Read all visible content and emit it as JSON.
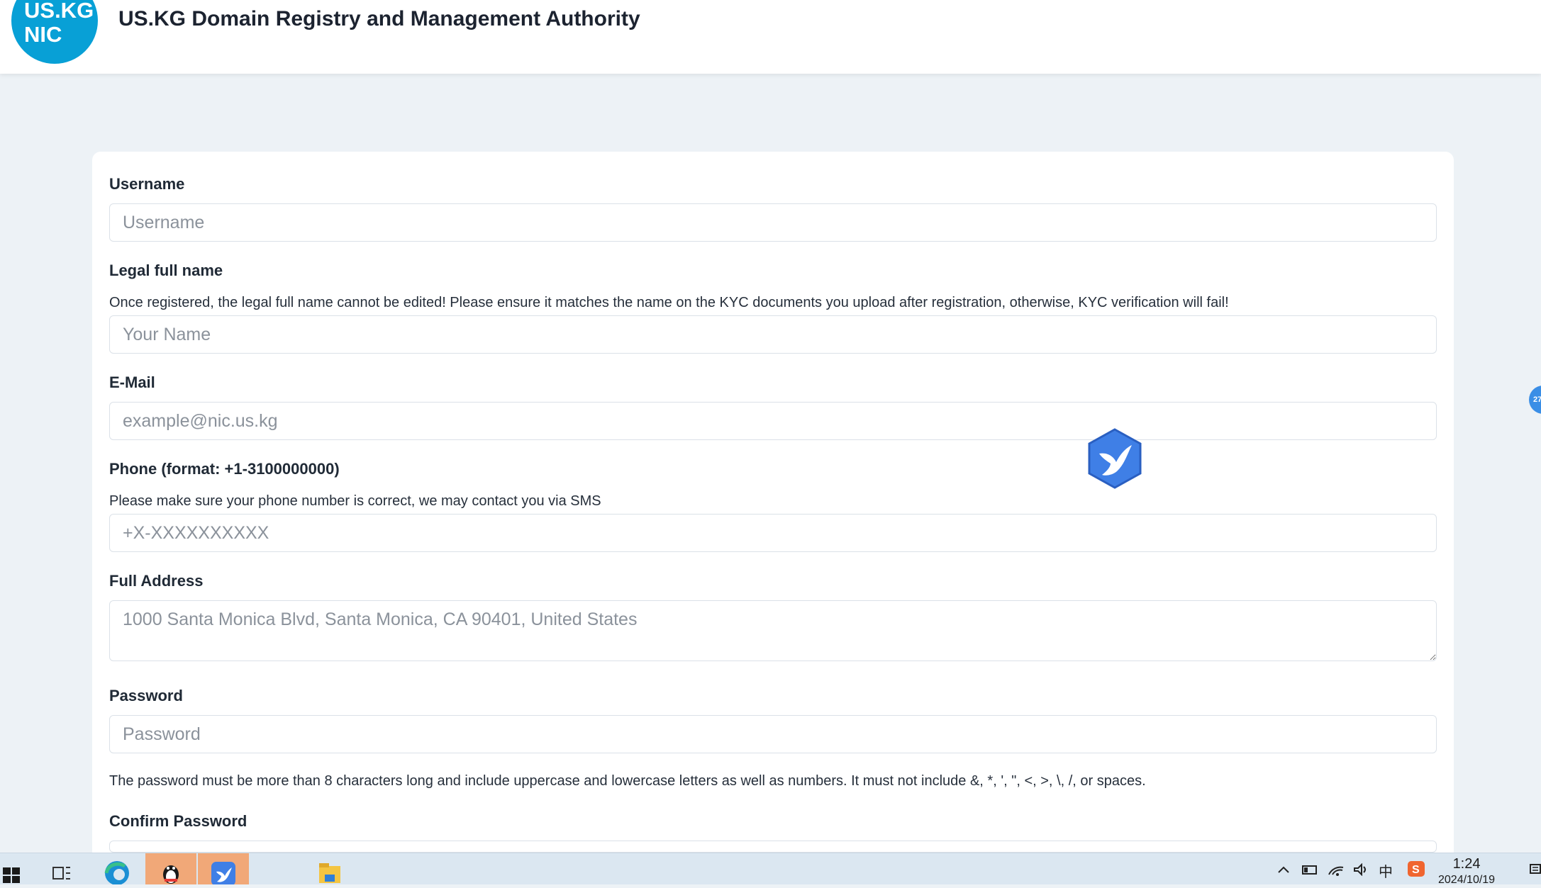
{
  "header": {
    "logo_line1": "US.KG",
    "logo_line2": "NIC",
    "title": "US.KG Domain Registry and Management Authority"
  },
  "form": {
    "username": {
      "label": "Username",
      "placeholder": "Username"
    },
    "legal_name": {
      "label": "Legal full name",
      "help": "Once registered, the legal full name cannot be edited! Please ensure it matches the name on the KYC documents you upload after registration, otherwise, KYC verification will fail!",
      "placeholder": "Your Name"
    },
    "email": {
      "label": "E-Mail",
      "placeholder": "example@nic.us.kg"
    },
    "phone": {
      "label": "Phone (format: +1-3100000000)",
      "help": "Please make sure your phone number is correct, we may contact you via SMS",
      "placeholder": "+X-XXXXXXXXXX"
    },
    "address": {
      "label": "Full Address",
      "placeholder": "1000 Santa Monica Blvd, Santa Monica, CA 90401, United States"
    },
    "password": {
      "label": "Password",
      "placeholder": "Password",
      "help": "The password must be more than 8 characters long and include uppercase and lowercase letters as well as numbers. It must not include &, *, ', \", <, >, \\, /, or spaces."
    },
    "confirm_password": {
      "label": "Confirm Password"
    }
  },
  "side_badge": {
    "text": "27"
  },
  "taskbar": {
    "time": "1:24",
    "date": "2024/10/19",
    "ime_label": "中"
  },
  "colors": {
    "logo": "#08a0d6",
    "page_bg": "#edf2f6",
    "taskbar_bg": "#dbe7f1"
  }
}
